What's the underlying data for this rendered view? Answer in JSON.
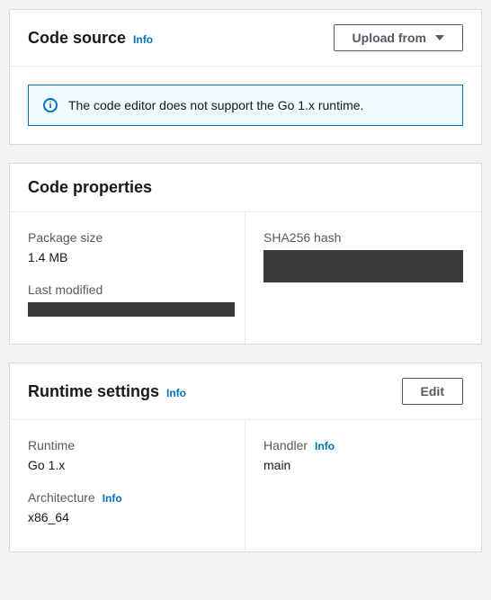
{
  "codeSource": {
    "title": "Code source",
    "infoLabel": "Info",
    "uploadButton": "Upload from",
    "alertMessage": "The code editor does not support the Go 1.x runtime."
  },
  "codeProperties": {
    "title": "Code properties",
    "packageSize": {
      "label": "Package size",
      "value": "1.4 MB"
    },
    "sha256": {
      "label": "SHA256 hash"
    },
    "lastModified": {
      "label": "Last modified"
    }
  },
  "runtimeSettings": {
    "title": "Runtime settings",
    "infoLabel": "Info",
    "editButton": "Edit",
    "runtime": {
      "label": "Runtime",
      "value": "Go 1.x"
    },
    "handler": {
      "label": "Handler",
      "infoLabel": "Info",
      "value": "main"
    },
    "architecture": {
      "label": "Architecture",
      "infoLabel": "Info",
      "value": "x86_64"
    }
  }
}
